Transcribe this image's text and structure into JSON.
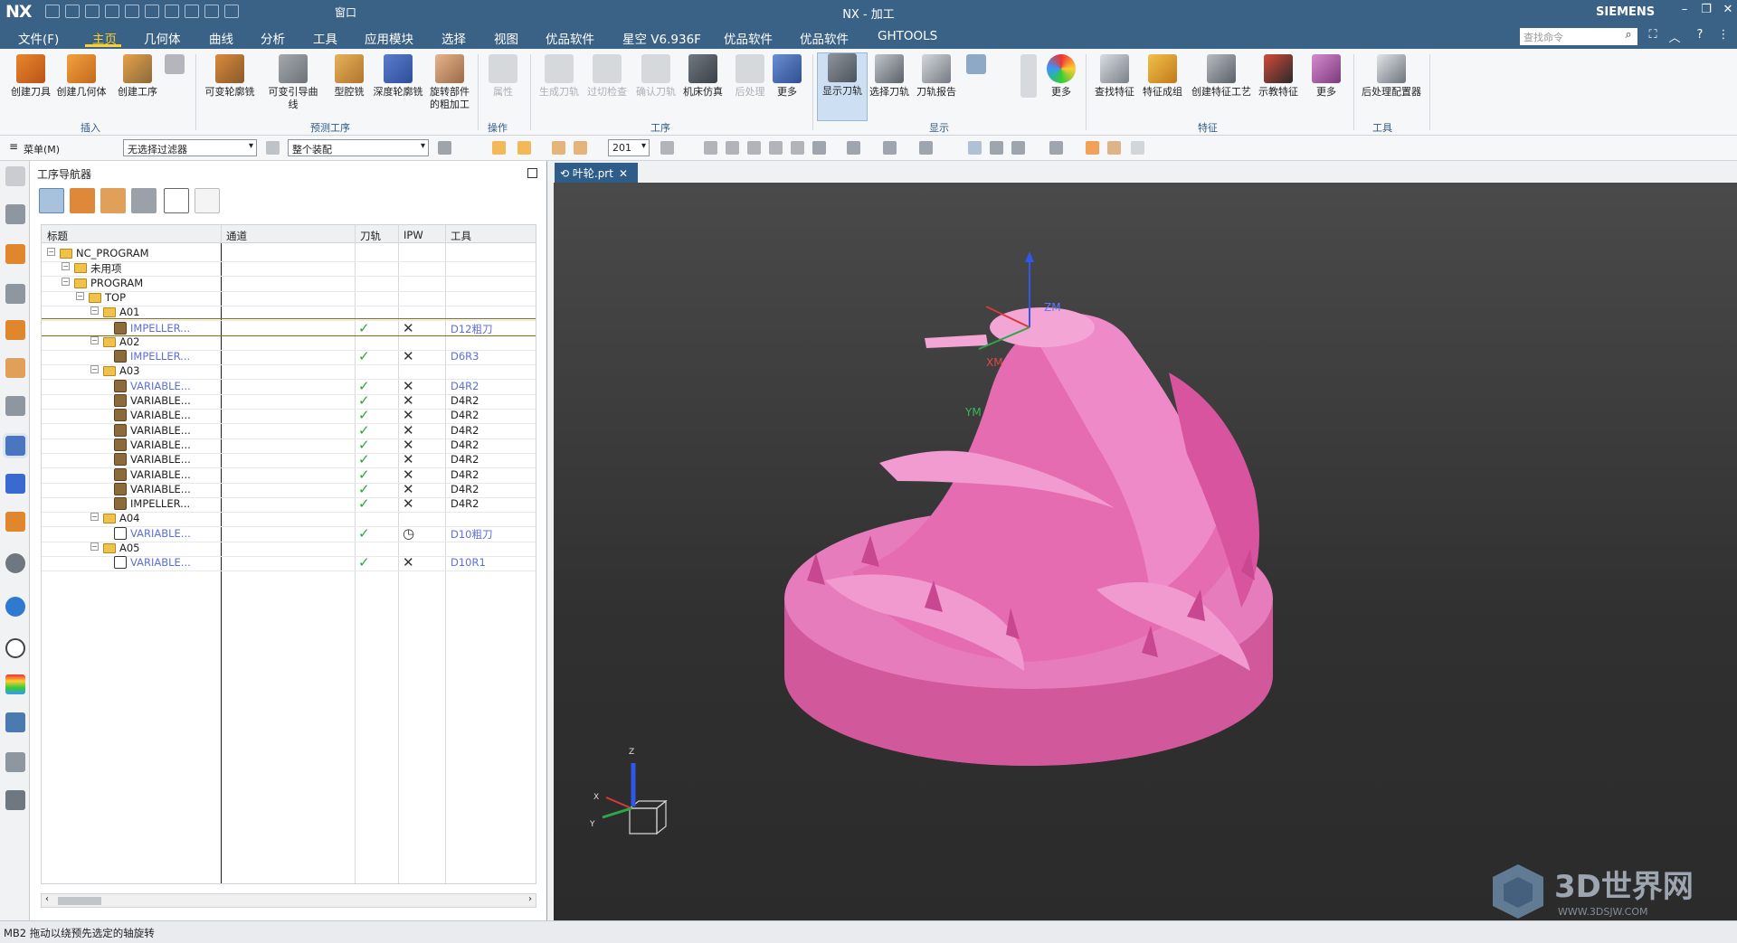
{
  "titlebar": {
    "logo": "NX",
    "window_menu": "窗口",
    "title": "NX - 加工",
    "brand": "SIEMENS"
  },
  "menu": {
    "items": [
      "文件(F)",
      "主页",
      "几何体",
      "曲线",
      "分析",
      "工具",
      "应用模块",
      "选择",
      "视图",
      "优品软件",
      "星空 V6.936F",
      "优品软件",
      "优品软件",
      "GHTOOLS"
    ],
    "search_placeholder": "查找命令"
  },
  "ribbon": {
    "buttons": [
      "创建刀具",
      "创建几何体",
      "创建工序",
      "可变轮廓铣",
      "可变引导曲线",
      "型腔铣",
      "深度轮廓铣",
      "旋转部件\n的粗加工",
      "属性",
      "生成刀轨",
      "过切检查",
      "确认刀轨",
      "机床仿真",
      "后处理",
      "更多",
      "显示刀轨",
      "选择刀轨",
      "刀轨报告",
      "更多",
      "查找特征",
      "特征成组",
      "创建特征工艺",
      "示教特征",
      "更多",
      "后处理配置器"
    ],
    "groups": [
      "插入",
      "预测工序",
      "操作",
      "工序",
      "显示",
      "特征",
      "工具"
    ]
  },
  "filterbar": {
    "menu": "菜单(M)",
    "filter": "无选择过滤器",
    "assembly": "整个装配",
    "layer": "201"
  },
  "navigator": {
    "title": "工序导航器",
    "columns": [
      "标题",
      "通道",
      "刀轨",
      "IPW",
      "工具"
    ],
    "rows": [
      {
        "name": "NC_PROGRAM",
        "level": 0,
        "type": "folder",
        "tool": "",
        "path": false,
        "ipw": ""
      },
      {
        "name": "未用项",
        "level": 1,
        "type": "folder",
        "tool": "",
        "path": false,
        "ipw": ""
      },
      {
        "name": "PROGRAM",
        "level": 1,
        "type": "folder",
        "tool": "",
        "path": false,
        "ipw": ""
      },
      {
        "name": "TOP",
        "level": 2,
        "type": "folder",
        "tool": "",
        "path": false,
        "ipw": ""
      },
      {
        "name": "A01",
        "level": 3,
        "type": "folder",
        "tool": "",
        "path": false,
        "ipw": ""
      },
      {
        "name": "IMPELLER...",
        "level": 4,
        "type": "op",
        "blue": true,
        "tool": "D12粗刀",
        "path": true,
        "ipw": "✕",
        "selected": true
      },
      {
        "name": "A02",
        "level": 3,
        "type": "folder",
        "tool": "",
        "path": false,
        "ipw": ""
      },
      {
        "name": "IMPELLER...",
        "level": 4,
        "type": "op",
        "blue": true,
        "tool": "D6R3",
        "path": true,
        "ipw": "✕"
      },
      {
        "name": "A03",
        "level": 3,
        "type": "folder",
        "tool": "",
        "path": false,
        "ipw": ""
      },
      {
        "name": "VARIABLE...",
        "level": 4,
        "type": "op",
        "blue": true,
        "tool": "D4R2",
        "path": true,
        "ipw": "✕"
      },
      {
        "name": "VARIABLE...",
        "level": 4,
        "type": "op",
        "blue": false,
        "tool": "D4R2",
        "path": true,
        "ipw": "✕"
      },
      {
        "name": "VARIABLE...",
        "level": 4,
        "type": "op",
        "blue": false,
        "tool": "D4R2",
        "path": true,
        "ipw": "✕"
      },
      {
        "name": "VARIABLE...",
        "level": 4,
        "type": "op",
        "blue": false,
        "tool": "D4R2",
        "path": true,
        "ipw": "✕"
      },
      {
        "name": "VARIABLE...",
        "level": 4,
        "type": "op",
        "blue": false,
        "tool": "D4R2",
        "path": true,
        "ipw": "✕"
      },
      {
        "name": "VARIABLE...",
        "level": 4,
        "type": "op",
        "blue": false,
        "tool": "D4R2",
        "path": true,
        "ipw": "✕"
      },
      {
        "name": "VARIABLE...",
        "level": 4,
        "type": "op",
        "blue": false,
        "tool": "D4R2",
        "path": true,
        "ipw": "✕"
      },
      {
        "name": "VARIABLE...",
        "level": 4,
        "type": "op",
        "blue": false,
        "tool": "D4R2",
        "path": true,
        "ipw": "✕"
      },
      {
        "name": "IMPELLER...",
        "level": 4,
        "type": "op",
        "blue": false,
        "tool": "D4R2",
        "path": true,
        "ipw": "✕"
      },
      {
        "name": "A04",
        "level": 3,
        "type": "folder",
        "tool": "",
        "path": false,
        "ipw": ""
      },
      {
        "name": "VARIABLE...",
        "level": 4,
        "type": "op2",
        "blue": true,
        "tool": "D10粗刀",
        "path": true,
        "ipw": "◷"
      },
      {
        "name": "A05",
        "level": 3,
        "type": "folder",
        "tool": "",
        "path": false,
        "ipw": ""
      },
      {
        "name": "VARIABLE...",
        "level": 4,
        "type": "op2",
        "blue": true,
        "tool": "D10R1",
        "path": true,
        "ipw": "✕"
      }
    ]
  },
  "viewport": {
    "tab": "叶轮.prt",
    "axes": {
      "z": "ZM",
      "x": "XM",
      "y": "YM"
    },
    "mini_axes": {
      "z": "Z",
      "x": "X",
      "y": "Y"
    },
    "model_color": "#e76cb0",
    "watermark": "3D世界网",
    "watermark_url": "WWW.3DSJW.COM"
  },
  "status": "MB2 拖动以绕预先选定的轴旋转"
}
